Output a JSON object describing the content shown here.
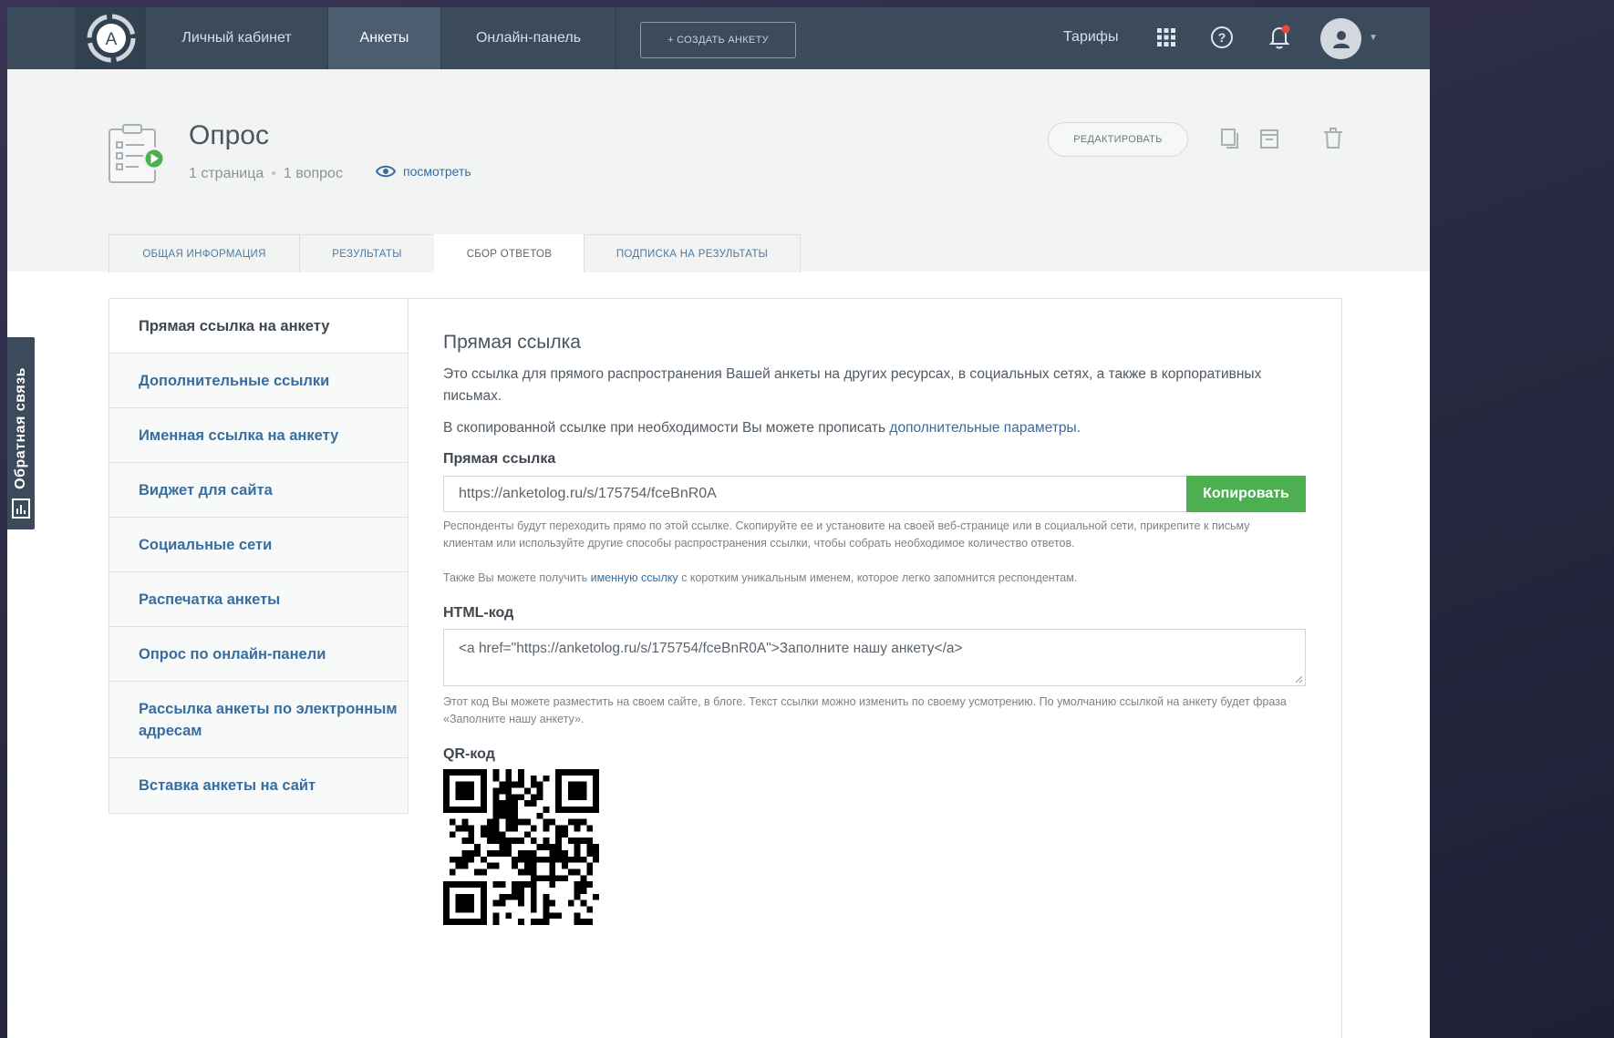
{
  "nav": {
    "items": [
      "Личный кабинет",
      "Анкеты",
      "Онлайн-панель"
    ],
    "create_label": "+ СОЗДАТЬ АНКЕТУ",
    "tariffs_label": "Тарифы",
    "logo_letter": "A"
  },
  "survey": {
    "title": "Опрос",
    "pages": "1 страница",
    "questions": "1 вопрос",
    "view_label": "посмотреть",
    "edit_label": "РЕДАКТИРОВАТЬ"
  },
  "tabs": [
    {
      "label": "ОБЩАЯ ИНФОРМАЦИЯ",
      "active": false
    },
    {
      "label": "РЕЗУЛЬТАТЫ",
      "active": false
    },
    {
      "label": "СБОР ОТВЕТОВ",
      "active": true
    },
    {
      "label": "ПОДПИСКА НА РЕЗУЛЬТАТЫ",
      "active": false
    }
  ],
  "side_menu": [
    {
      "label": "Прямая ссылка на анкету",
      "active": true
    },
    {
      "label": "Дополнительные ссылки",
      "active": false
    },
    {
      "label": "Именная ссылка на анкету",
      "active": false
    },
    {
      "label": "Виджет для сайта",
      "active": false
    },
    {
      "label": "Социальные сети",
      "active": false
    },
    {
      "label": "Распечатка анкеты",
      "active": false
    },
    {
      "label": "Опрос по онлайн-панели",
      "active": false
    },
    {
      "label": "Рассылка анкеты по электронным адресам",
      "active": false
    },
    {
      "label": "Вставка анкеты на сайт",
      "active": false
    }
  ],
  "main": {
    "title": "Прямая ссылка",
    "intro": "Это ссылка для прямого распространения Вашей анкеты на других ресурсах, в социальных сетях, а также в корпоративных письмах.",
    "params_prefix": "В скопированной ссылке при необходимости Вы можете прописать ",
    "params_link": "дополнительные параметры",
    "params_suffix": ".",
    "link_label": "Прямая ссылка",
    "link_value": "https://anketolog.ru/s/175754/fceBnR0A",
    "copy_label": "Копировать",
    "hint1": "Респонденты будут переходить прямо по этой ссылке. Скопируйте ее и установите на своей веб-странице или в социальной сети, прикрепите к письму клиентам или используйте другие способы распространения ссылки, чтобы собрать необходимое количество ответов.",
    "hint2_prefix": "Также Вы можете получить ",
    "hint2_link": "именную ссылку",
    "hint2_suffix": " с коротким уникальным именем, которое легко запомнится респондентам.",
    "html_label": "HTML-код",
    "html_value": "<a href=\"https://anketolog.ru/s/175754/fceBnR0A\">Заполните нашу анкету</a>",
    "html_hint": "Этот код Вы можете разместить на своем сайте, в блоге. Текст ссылки можно изменить по своему усмотрению. По умолчанию ссылкой на анкету будет фраза «Заполните нашу анкету».",
    "qr_label": "QR-код"
  },
  "feedback_label": "Обратная связь",
  "colors": {
    "nav_bg": "#3b4b5c",
    "accent_link": "#3a6d9e",
    "copy_green": "#4caf50"
  }
}
